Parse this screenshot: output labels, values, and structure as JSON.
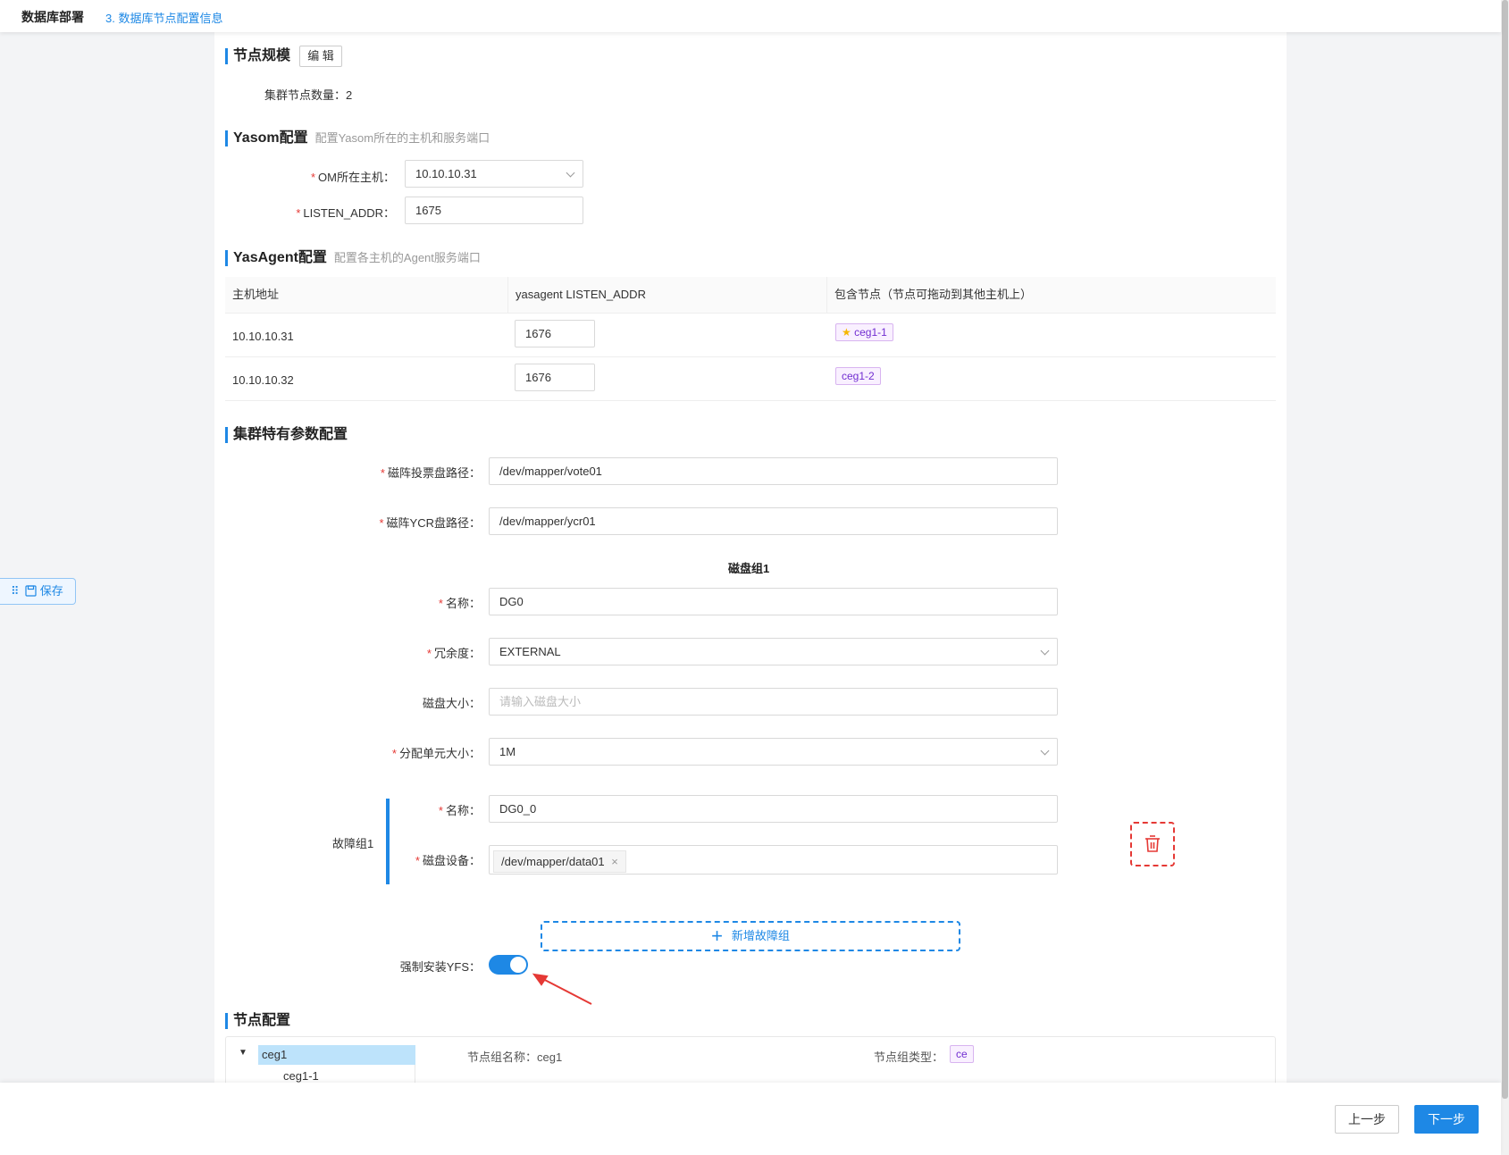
{
  "header": {
    "app_title": "数据库部署",
    "step": "3. 数据库节点配置信息"
  },
  "node_scale": {
    "title": "节点规模",
    "edit_label": "编 辑",
    "count_text": "集群节点数量：2"
  },
  "yasom": {
    "title": "Yasom配置",
    "subtitle": "配置Yasom所在的主机和服务端口",
    "om_host_label": "OM所在主机：",
    "om_host_value": "10.10.10.31",
    "listen_label": "LISTEN_ADDR：",
    "listen_value": "1675"
  },
  "yasagent": {
    "title": "YasAgent配置",
    "subtitle": "配置各主机的Agent服务端口",
    "columns": [
      "主机地址",
      "yasagent LISTEN_ADDR",
      "包含节点（节点可拖动到其他主机上）"
    ],
    "rows": [
      {
        "host": "10.10.10.31",
        "port": "1676",
        "node": "ceg1-1"
      },
      {
        "host": "10.10.10.32",
        "port": "1676",
        "node": "ceg1-2"
      }
    ]
  },
  "cluster": {
    "title": "集群特有参数配置",
    "vote_label": "磁阵投票盘路径：",
    "vote_value": "/dev/mapper/vote01",
    "ycr_label": "磁阵YCR盘路径：",
    "ycr_value": "/dev/mapper/ycr01",
    "disk_group_title": "磁盘组1",
    "name_label": "名称：",
    "name_value": "DG0",
    "redundancy_label": "冗余度：",
    "redundancy_value": "EXTERNAL",
    "disk_size_label": "磁盘大小：",
    "disk_size_placeholder": "请输入磁盘大小",
    "alloc_label": "分配单元大小：",
    "alloc_value": "1M",
    "failgroup_label": "故障组1",
    "fg_name_label": "名称：",
    "fg_name_value": "DG0_0",
    "fg_disk_label": "磁盘设备：",
    "fg_disk_tag": "/dev/mapper/data01",
    "add_failgroup_label": "新增故障组",
    "force_yfs_label": "强制安装YFS：",
    "force_yfs_on": true
  },
  "node_config": {
    "title": "节点配置",
    "tree_root": "ceg1",
    "tree_child": "ceg1-1",
    "group_name_text": "节点组名称：ceg1",
    "group_type_label": "节点组类型：",
    "group_type_value": "ce"
  },
  "float": {
    "save_label": "保存"
  },
  "footer": {
    "prev_label": "上一步",
    "next_label": "下一步"
  },
  "colors": {
    "accent": "#1e88e5",
    "required": "#e53935",
    "node_tag": "#722ed1",
    "annotation_arrow": "#e53935"
  }
}
